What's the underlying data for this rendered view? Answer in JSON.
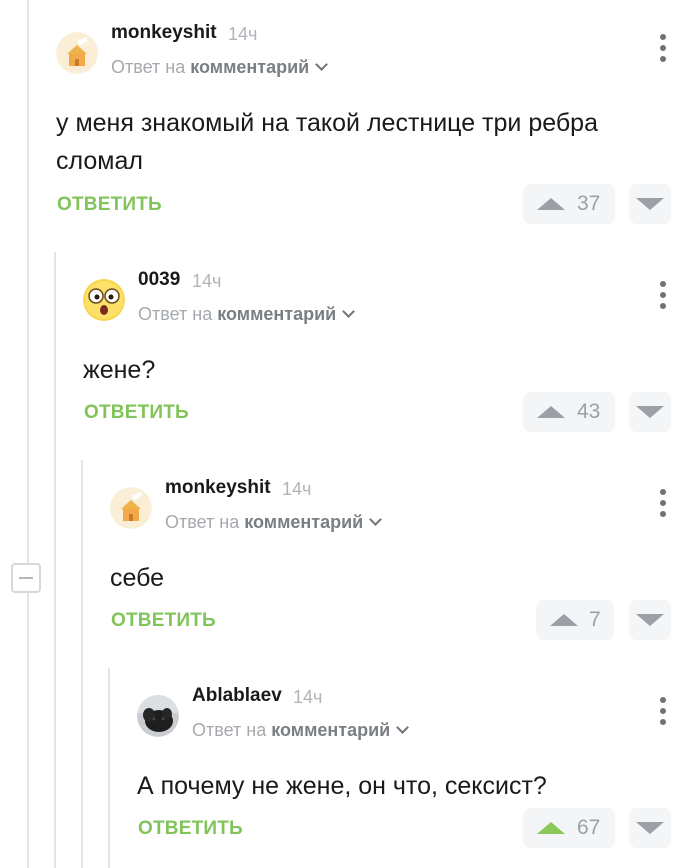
{
  "comments": [
    {
      "username": "monkeyshit",
      "time": "14ч",
      "reply_prefix": "Ответ на",
      "reply_link": "комментарий",
      "text_lines": [
        "у меня знакомый на такой лестнице три ребра",
        "сломал"
      ],
      "reply_label": "ОТВЕТИТЬ",
      "votes": "37",
      "avatar": "house-avatar",
      "upvoted": false
    },
    {
      "username": "0039",
      "time": "14ч",
      "reply_prefix": "Ответ на",
      "reply_link": "комментарий",
      "text_lines": [
        "жене?"
      ],
      "reply_label": "ОТВЕТИТЬ",
      "votes": "43",
      "avatar": "shocked-face-avatar",
      "upvoted": false
    },
    {
      "username": "monkeyshit",
      "time": "14ч",
      "reply_prefix": "Ответ на",
      "reply_link": "комментарий",
      "text_lines": [
        "себе"
      ],
      "reply_label": "ОТВЕТИТЬ",
      "votes": "7",
      "avatar": "house-avatar",
      "upvoted": false
    },
    {
      "username": "Ablablaev",
      "time": "14ч",
      "reply_prefix": "Ответ на",
      "reply_link": "комментарий",
      "text_lines": [
        "А почему не жене, он что, сексист?"
      ],
      "reply_label": "ОТВЕТИТЬ",
      "votes": "67",
      "avatar": "black-dog-avatar",
      "upvoted": true
    }
  ],
  "colors": {
    "accent_green": "#80c45a",
    "upvoted_green": "#8ac858",
    "muted_gray": "#9aa0a6"
  }
}
